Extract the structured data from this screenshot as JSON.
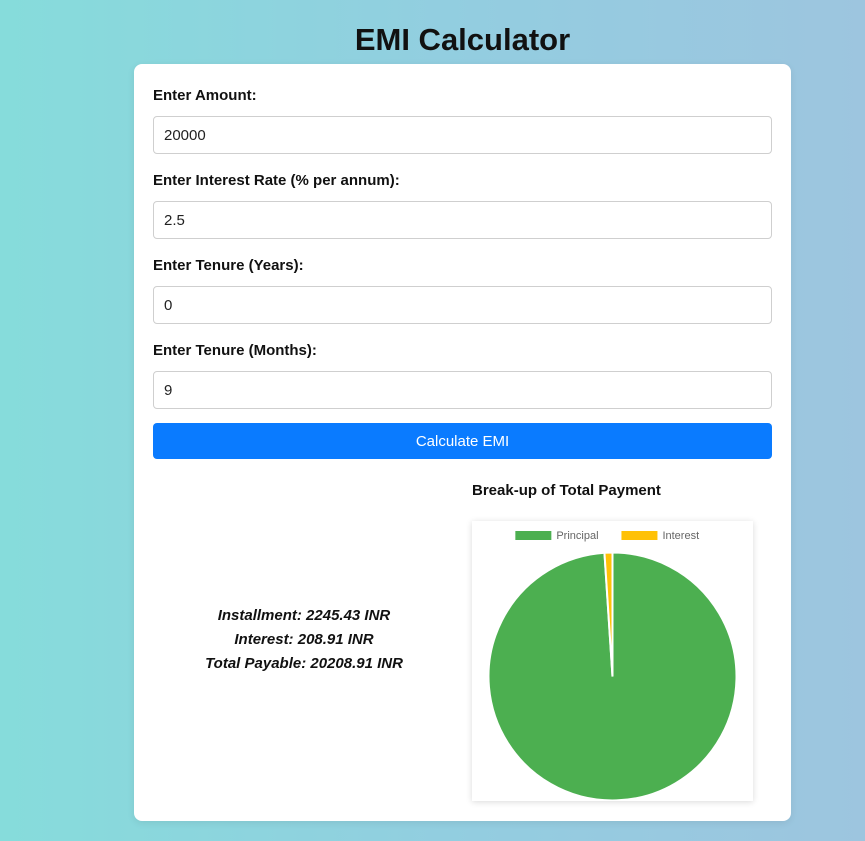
{
  "page": {
    "title": "EMI Calculator"
  },
  "form": {
    "amount": {
      "label": "Enter Amount:",
      "value": "20000"
    },
    "interest_rate": {
      "label": "Enter Interest Rate (% per annum):",
      "value": "2.5"
    },
    "tenure_years": {
      "label": "Enter Tenure (Years):",
      "value": "0"
    },
    "tenure_months": {
      "label": "Enter Tenure (Months):",
      "value": "9"
    },
    "button_label": "Calculate EMI"
  },
  "results": {
    "installment": "Installment: 2245.43 INR",
    "interest": "Interest: 208.91 INR",
    "total_payable": "Total Payable: 20208.91 INR"
  },
  "chart_data": {
    "type": "pie",
    "title": "Break-up of Total Payment",
    "categories": [
      "Principal",
      "Interest"
    ],
    "values": [
      20000,
      208.91
    ],
    "colors": [
      "#4caf50",
      "#ffc107"
    ],
    "legend": "top"
  },
  "colors": {
    "accent": "#0a7bff",
    "principal": "#4caf50",
    "interest": "#ffc107"
  }
}
